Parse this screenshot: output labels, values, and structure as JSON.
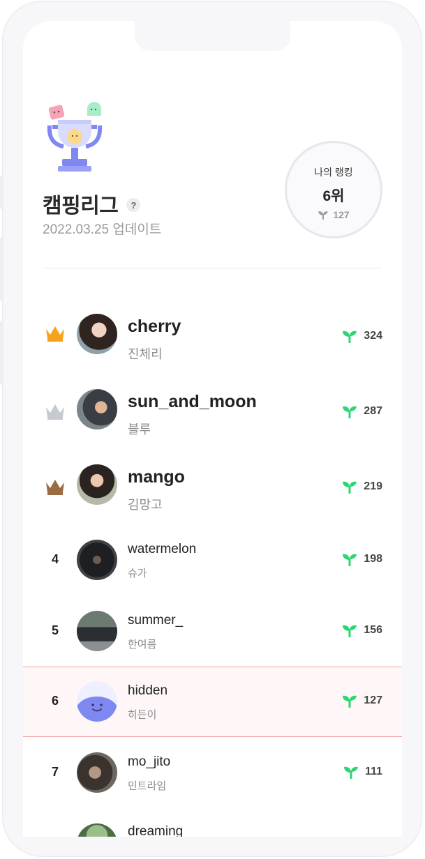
{
  "header": {
    "league_title": "캠핑리그",
    "help_label": "?",
    "update_date": "2022.03.25 업데이트"
  },
  "my_rank": {
    "label": "나의 랭킹",
    "rank": "6위",
    "points": "127"
  },
  "colors": {
    "sprout": "#2ed573",
    "gold": "#f7a21b",
    "silver": "#c7c9d1",
    "bronze": "#9b6b43",
    "highlight_border": "#f1a1a1",
    "trophy_purple": "#7f87f1"
  },
  "leaderboard": [
    {
      "rank": "",
      "crown": "gold-crown-icon",
      "nickname": "cherry",
      "name": "진체리",
      "score": "324"
    },
    {
      "rank": "",
      "crown": "silver-crown-icon",
      "nickname": "sun_and_moon",
      "name": "블루",
      "score": "287"
    },
    {
      "rank": "",
      "crown": "bronze-crown-icon",
      "nickname": "mango",
      "name": "김망고",
      "score": "219"
    },
    {
      "rank": "4",
      "nickname": "watermelon",
      "name": "슈가",
      "score": "198"
    },
    {
      "rank": "5",
      "nickname": "summer_",
      "name": "한여름",
      "score": "156"
    },
    {
      "rank": "6",
      "nickname": "hidden",
      "name": "히든이",
      "score": "127",
      "is_me": true
    },
    {
      "rank": "7",
      "nickname": "mo_jito",
      "name": "민트라임",
      "score": "111"
    },
    {
      "rank": "",
      "nickname": "dreaming_",
      "name": "",
      "score": ""
    }
  ]
}
